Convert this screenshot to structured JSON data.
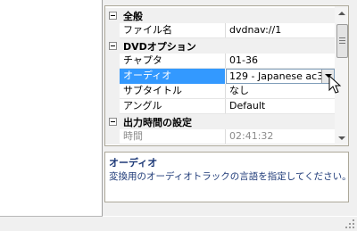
{
  "property_grid": {
    "categories": [
      {
        "label": "全般",
        "items": [
          {
            "name": "ファイル名",
            "value": "dvdnav://1"
          }
        ]
      },
      {
        "label": "DVDオプション",
        "items": [
          {
            "name": "チャプタ",
            "value": "01-36"
          },
          {
            "name": "オーディオ",
            "value": "129 - Japanese ac3",
            "selected": true
          },
          {
            "name": "サブタイトル",
            "value": "なし"
          },
          {
            "name": "アングル",
            "value": "Default"
          }
        ]
      },
      {
        "label": "出力時間の設定",
        "items": [
          {
            "name": "時間",
            "value": "02:41:32",
            "disabled": true
          }
        ]
      }
    ]
  },
  "description": {
    "title": "オーディオ",
    "text": "変換用のオーディオトラックの言語を指定してください。"
  },
  "icons": {
    "collapse": "minus-box-icon",
    "dropdown": "chevron-down-icon",
    "cursor": "mouse-pointer-icon",
    "resize": "resize-grip-icon"
  },
  "colors": {
    "selection": "#3399ff",
    "description_text": "#1e3a78",
    "disabled_text": "#8c8c8c"
  }
}
